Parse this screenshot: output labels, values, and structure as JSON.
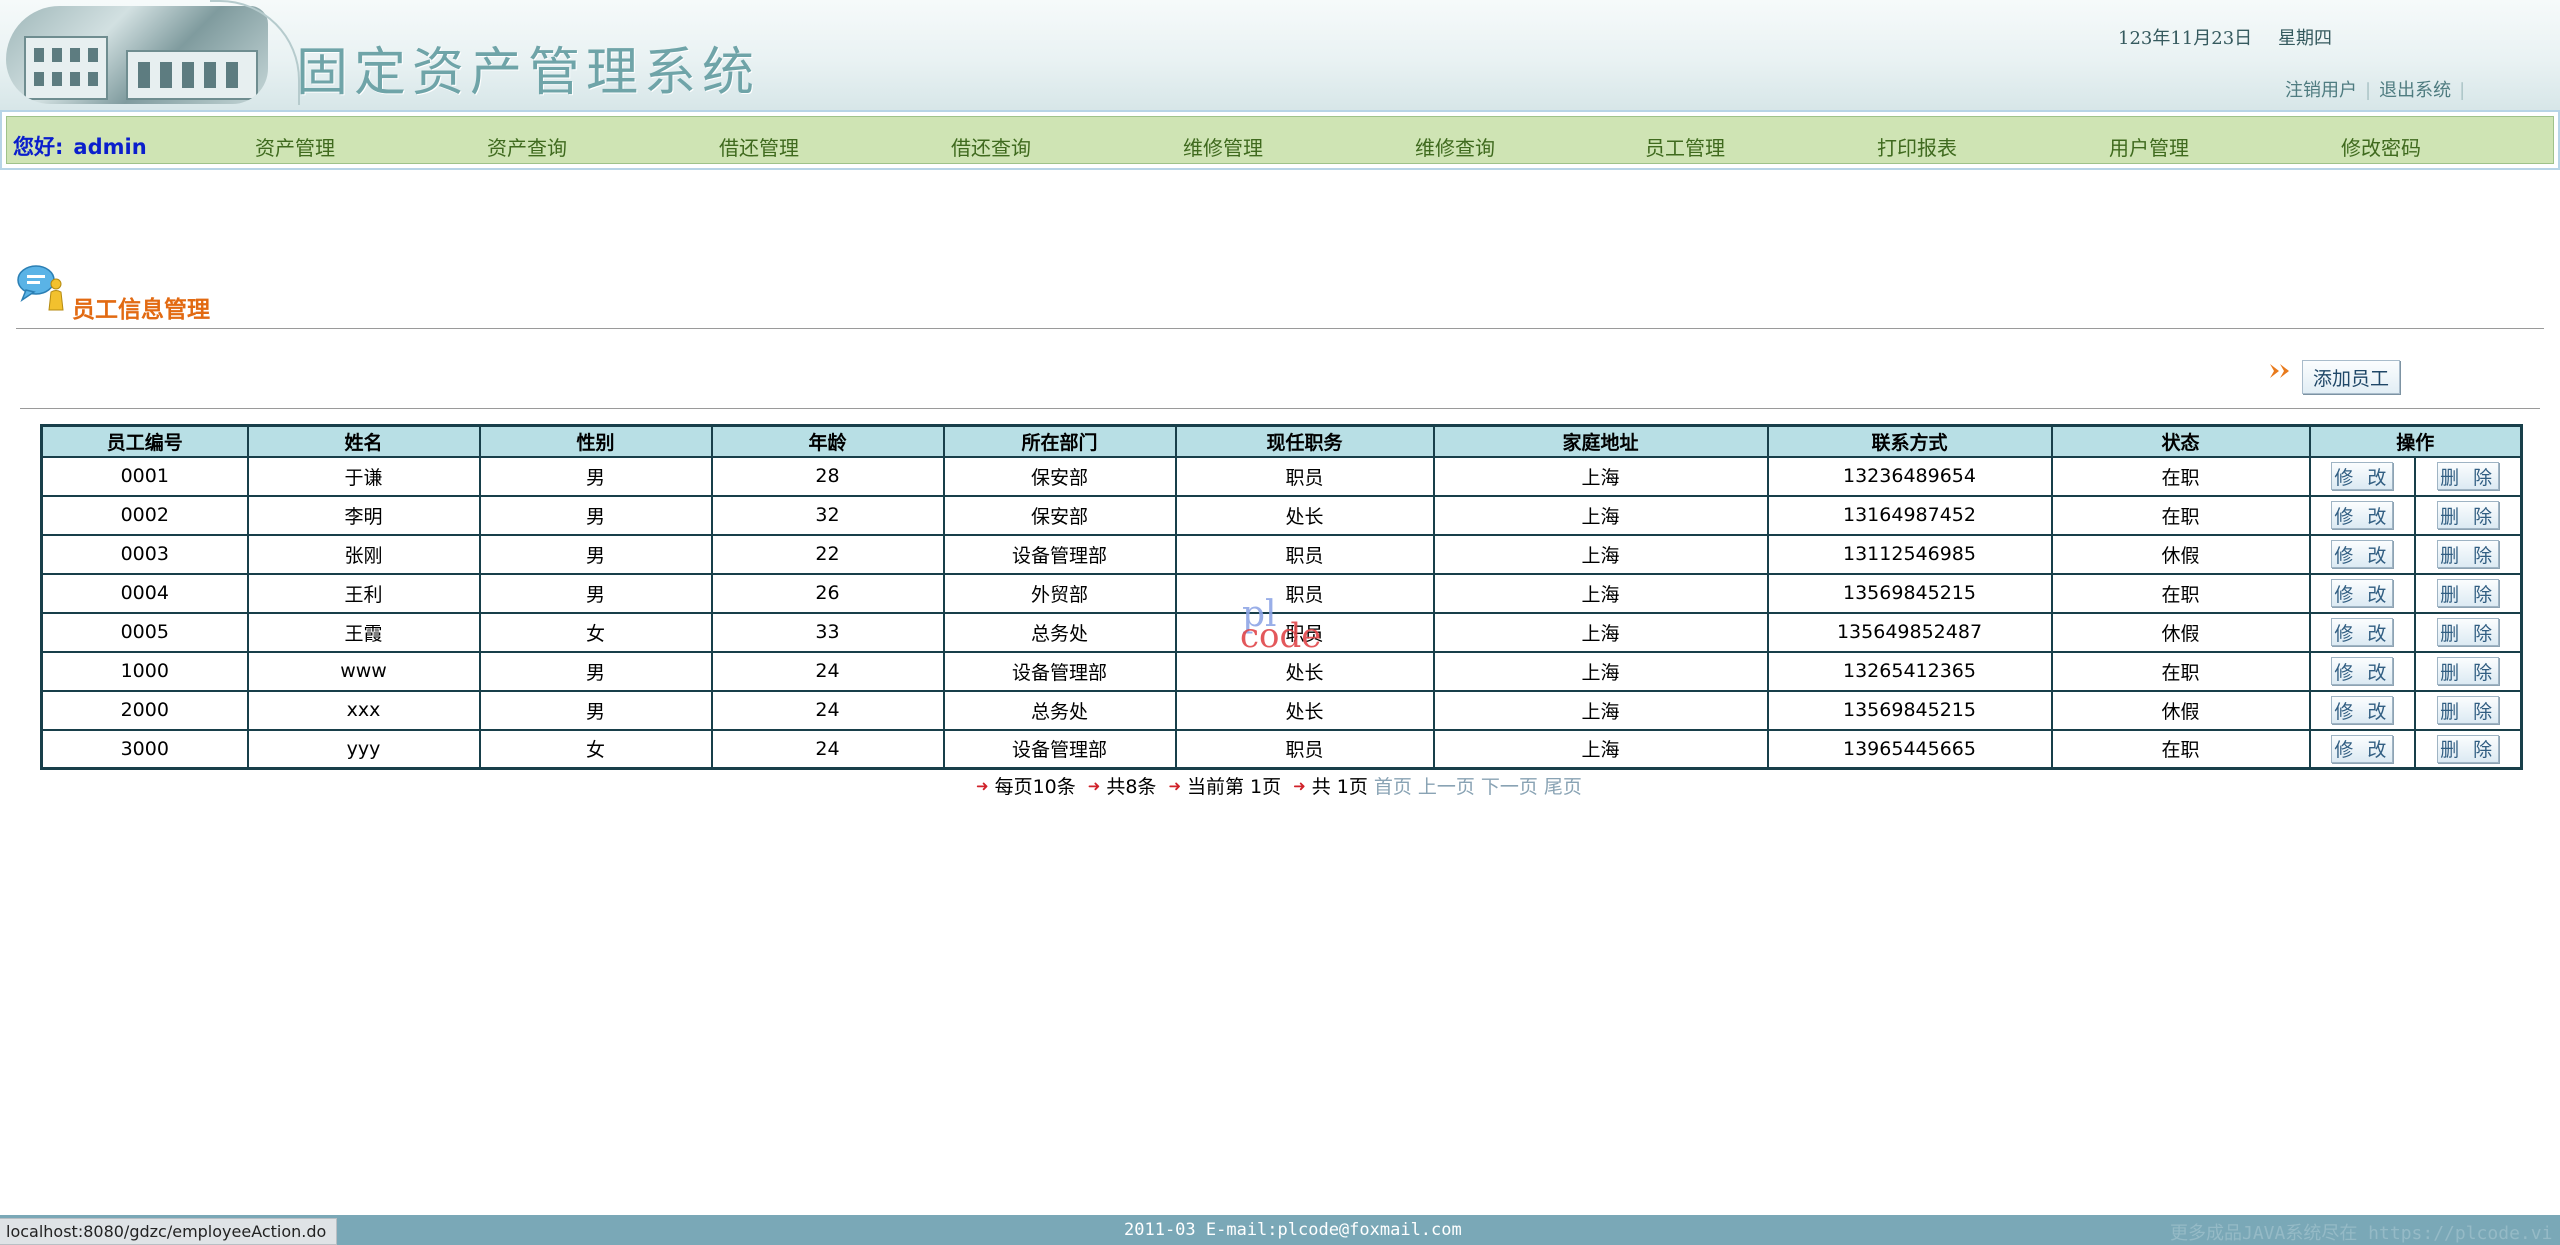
{
  "header": {
    "title": "固定资产管理系统",
    "date": "123年11月23日",
    "weekday": "星期四",
    "links": [
      "注销用户",
      "退出系统"
    ],
    "link_separator": "|"
  },
  "nav": {
    "greeting": "您好:",
    "username": "admin",
    "items": [
      "资产管理",
      "资产查询",
      "借还管理",
      "借还查询",
      "维修管理",
      "维修查询",
      "员工管理",
      "打印报表",
      "用户管理",
      "修改密码"
    ]
  },
  "section": {
    "title": "员工信息管理",
    "add_button": "添加员工"
  },
  "table": {
    "columns": [
      "员工编号",
      "姓名",
      "性别",
      "年龄",
      "所在部门",
      "现任职务",
      "家庭地址",
      "联系方式",
      "状态",
      "操作"
    ],
    "edit_label": "修 改",
    "delete_label": "删 除",
    "rows": [
      [
        "0001",
        "于谦",
        "男",
        "28",
        "保安部",
        "职员",
        "上海",
        "13236489654",
        "在职"
      ],
      [
        "0002",
        "李明",
        "男",
        "32",
        "保安部",
        "处长",
        "上海",
        "13164987452",
        "在职"
      ],
      [
        "0003",
        "张刚",
        "男",
        "22",
        "设备管理部",
        "职员",
        "上海",
        "13112546985",
        "休假"
      ],
      [
        "0004",
        "王利",
        "男",
        "26",
        "外贸部",
        "职员",
        "上海",
        "13569845215",
        "在职"
      ],
      [
        "0005",
        "王霞",
        "女",
        "33",
        "总务处",
        "职员",
        "上海",
        "135649852487",
        "休假"
      ],
      [
        "1000",
        "www",
        "男",
        "24",
        "设备管理部",
        "处长",
        "上海",
        "13265412365",
        "在职"
      ],
      [
        "2000",
        "xxx",
        "男",
        "24",
        "总务处",
        "处长",
        "上海",
        "13569845215",
        "休假"
      ],
      [
        "3000",
        "yyy",
        "女",
        "24",
        "设备管理部",
        "职员",
        "上海",
        "13965445665",
        "在职"
      ]
    ]
  },
  "pager": {
    "per_page": "每页10条",
    "total": "共8条",
    "current": "当前第 1页",
    "pages": "共 1页",
    "links": [
      "首页",
      "上一页",
      "下一页",
      "尾页"
    ]
  },
  "watermark": {
    "line1": "pl",
    "line2": "code"
  },
  "footer": {
    "text": "2011-03 E-mail:plcode@foxmail.com",
    "faint_text": "更多成品JAVA系统尽在 https://plcode.vi"
  },
  "status_bar": {
    "url": "localhost:8080/gdzc/employeeAction.do"
  },
  "colors": {
    "nav_bg": "#cfe4b4",
    "table_header_bg": "#b8dfe5",
    "section_title": "#e26a12",
    "greeting": "#0a1ecc",
    "footer_bg": "#7aa8b7"
  }
}
